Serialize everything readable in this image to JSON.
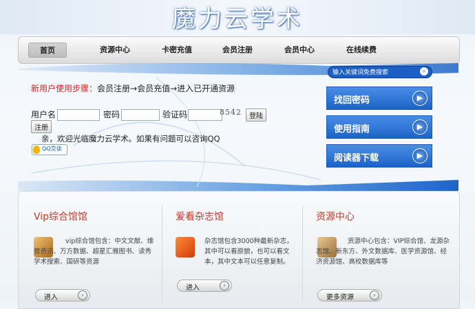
{
  "site_title": "魔力云学术",
  "nav": {
    "items": [
      "首页",
      "资源中心",
      "卡密充值",
      "会员注册",
      "会员中心",
      "在线续费"
    ]
  },
  "steps": {
    "label": "新用户使用步骤",
    "colon": "：",
    "text": "会员注册→会员充值→进入已开通资源",
    "label_color": "#d62020"
  },
  "login": {
    "username_label": "用户名",
    "password_label": "密码",
    "captcha_label": "验证码",
    "captcha_value": "8542",
    "login_button": "登陆",
    "register_button": "注册",
    "welcome": "亲，欢迎光临魔力云学术。如果有问题可以咨询QQ",
    "qq_button": "QQ交谈"
  },
  "sidebar": {
    "search_placeholder": "输入关键词免费搜索",
    "buttons": [
      "找回密码",
      "使用指南",
      "阅读器下载"
    ]
  },
  "panels": [
    {
      "title": "Vip综合馆馆",
      "description": "vip综合馆包含：中文文献、维普资讯、万方数据、超星汇雅图书、读秀学术搜索、国研等资源",
      "button": "进入",
      "icon": "book-person-icon"
    },
    {
      "title": "爱看杂志馆",
      "description": "杂志馆包含3000种最新杂志，其中可以看原貌，也可以看文本，其中文本可以任意复制。",
      "button": "进入",
      "icon": "magazine-icon"
    },
    {
      "title": "资源中心",
      "description": "资源中心包含：VIP综合馆、龙源杂志馆、新东方、外文数据库、医学资源馆、经济资源馆、高校数据库等",
      "button": "更多资源",
      "icon": "safe-icon"
    }
  ],
  "colors": {
    "accent_blue": "#1c63c7",
    "title_red": "#c0392b"
  }
}
